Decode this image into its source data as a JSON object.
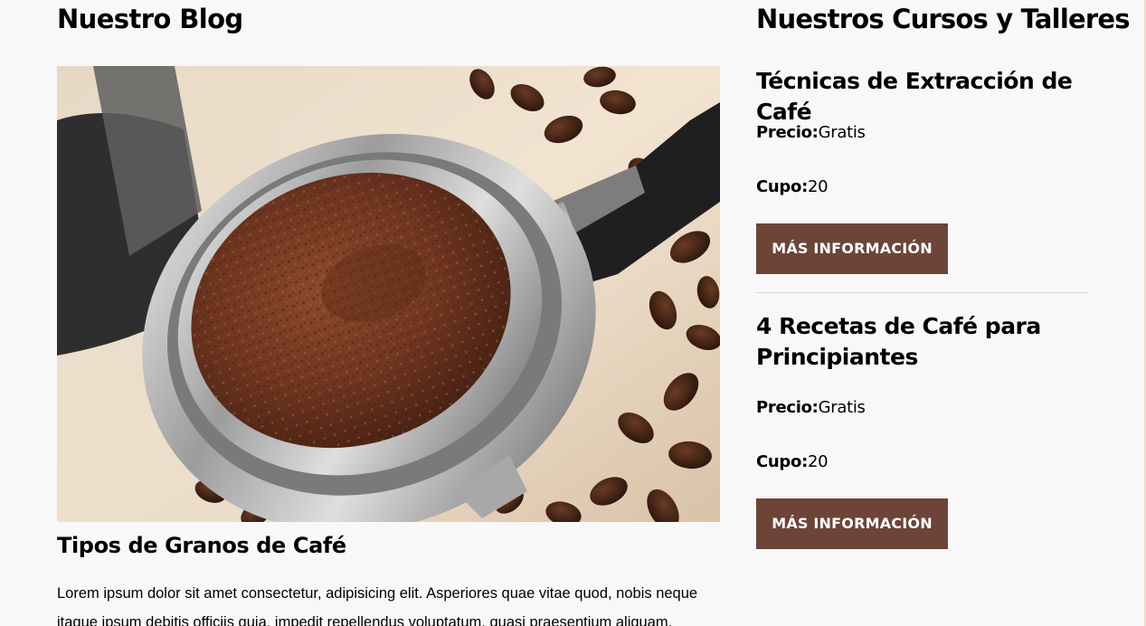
{
  "blog": {
    "title": "Nuestro Blog",
    "post": {
      "title": "Tipos de Granos de Café",
      "excerpt": "Lorem ipsum dolor sit amet consectetur, adipisicing elit. Asperiores quae vitae quod, nobis neque itaque ipsum debitis officiis quia, impedit repellendus voluptatum, quasi praesentium aliquam."
    }
  },
  "courses": {
    "title": "Nuestros Cursos y Talleres",
    "items": [
      {
        "title": "Técnicas de Extracción de Café",
        "price_label": "Precio:",
        "price": "Gratis",
        "quota_label": "Cupo:",
        "quota": "20",
        "button": "MÁS INFORMACIÓN"
      },
      {
        "title": "4 Recetas de Café para Principiantes",
        "price_label": "Precio:",
        "price": "Gratis",
        "quota_label": "Cupo:",
        "quota": "20",
        "button": "MÁS INFORMACIÓN"
      }
    ]
  },
  "colors": {
    "background": "#f8f8f8",
    "button": "#6c4438",
    "button_text": "#ffffff",
    "divider": "#d6d6d6"
  }
}
